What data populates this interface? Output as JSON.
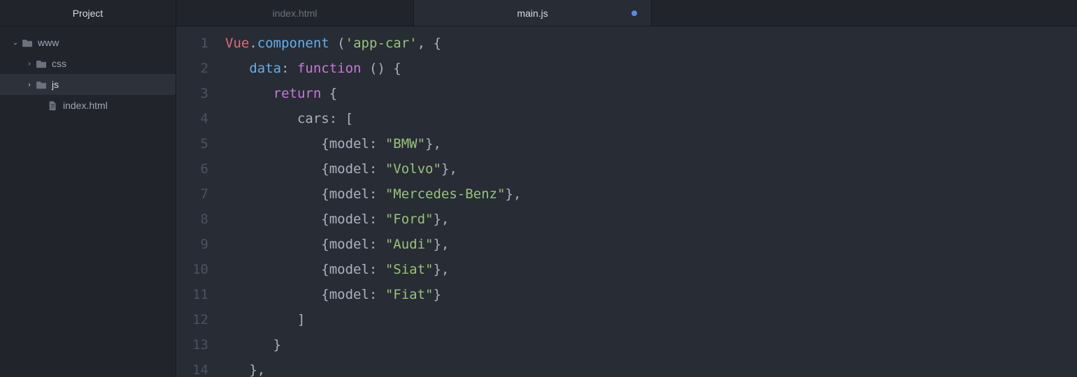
{
  "sidebar": {
    "title": "Project",
    "tree": [
      {
        "label": "www",
        "indent": 14,
        "arrow": "⌄",
        "icon": "folder",
        "selected": false
      },
      {
        "label": "css",
        "indent": 34,
        "arrow": "›",
        "icon": "folder",
        "selected": false
      },
      {
        "label": "js",
        "indent": 34,
        "arrow": "›",
        "icon": "folder",
        "selected": true
      },
      {
        "label": "index.html",
        "indent": 50,
        "arrow": "",
        "icon": "file",
        "selected": false
      }
    ]
  },
  "tabs": [
    {
      "label": "index.html",
      "active": false,
      "dirty": false
    },
    {
      "label": "main.js",
      "active": true,
      "dirty": true
    }
  ],
  "code": {
    "lines": [
      [
        {
          "c": "tok-red",
          "t": "Vue"
        },
        {
          "c": "tok-punct",
          "t": "."
        },
        {
          "c": "tok-blue",
          "t": "component"
        },
        {
          "c": "tok-punct",
          "t": " ("
        },
        {
          "c": "tok-str",
          "t": "'app-car'"
        },
        {
          "c": "tok-punct",
          "t": ", {"
        }
      ],
      [
        {
          "c": "tok-punct",
          "t": "   "
        },
        {
          "c": "tok-blue",
          "t": "data"
        },
        {
          "c": "tok-punct",
          "t": ": "
        },
        {
          "c": "tok-purple",
          "t": "function"
        },
        {
          "c": "tok-punct",
          "t": " () {"
        }
      ],
      [
        {
          "c": "tok-punct",
          "t": "      "
        },
        {
          "c": "tok-purple",
          "t": "return"
        },
        {
          "c": "tok-punct",
          "t": " {"
        }
      ],
      [
        {
          "c": "tok-punct",
          "t": "         "
        },
        {
          "c": "tok-gray",
          "t": "cars"
        },
        {
          "c": "tok-punct",
          "t": ": ["
        }
      ],
      [
        {
          "c": "tok-punct",
          "t": "            {"
        },
        {
          "c": "tok-gray",
          "t": "model"
        },
        {
          "c": "tok-punct",
          "t": ": "
        },
        {
          "c": "tok-str",
          "t": "\"BMW\""
        },
        {
          "c": "tok-punct",
          "t": "},"
        }
      ],
      [
        {
          "c": "tok-punct",
          "t": "            {"
        },
        {
          "c": "tok-gray",
          "t": "model"
        },
        {
          "c": "tok-punct",
          "t": ": "
        },
        {
          "c": "tok-str",
          "t": "\"Volvo\""
        },
        {
          "c": "tok-punct",
          "t": "},"
        }
      ],
      [
        {
          "c": "tok-punct",
          "t": "            {"
        },
        {
          "c": "tok-gray",
          "t": "model"
        },
        {
          "c": "tok-punct",
          "t": ": "
        },
        {
          "c": "tok-str",
          "t": "\"Mercedes-Benz\""
        },
        {
          "c": "tok-punct",
          "t": "},"
        }
      ],
      [
        {
          "c": "tok-punct",
          "t": "            {"
        },
        {
          "c": "tok-gray",
          "t": "model"
        },
        {
          "c": "tok-punct",
          "t": ": "
        },
        {
          "c": "tok-str",
          "t": "\"Ford\""
        },
        {
          "c": "tok-punct",
          "t": "},"
        }
      ],
      [
        {
          "c": "tok-punct",
          "t": "            {"
        },
        {
          "c": "tok-gray",
          "t": "model"
        },
        {
          "c": "tok-punct",
          "t": ": "
        },
        {
          "c": "tok-str",
          "t": "\"Audi\""
        },
        {
          "c": "tok-punct",
          "t": "},"
        }
      ],
      [
        {
          "c": "tok-punct",
          "t": "            {"
        },
        {
          "c": "tok-gray",
          "t": "model"
        },
        {
          "c": "tok-punct",
          "t": ": "
        },
        {
          "c": "tok-str",
          "t": "\"Siat\""
        },
        {
          "c": "tok-punct",
          "t": "},"
        }
      ],
      [
        {
          "c": "tok-punct",
          "t": "            {"
        },
        {
          "c": "tok-gray",
          "t": "model"
        },
        {
          "c": "tok-punct",
          "t": ": "
        },
        {
          "c": "tok-str",
          "t": "\"Fiat\""
        },
        {
          "c": "tok-punct",
          "t": "}"
        }
      ],
      [
        {
          "c": "tok-punct",
          "t": "         ]"
        }
      ],
      [
        {
          "c": "tok-punct",
          "t": "      }"
        }
      ],
      [
        {
          "c": "tok-punct",
          "t": "   },"
        }
      ]
    ]
  }
}
